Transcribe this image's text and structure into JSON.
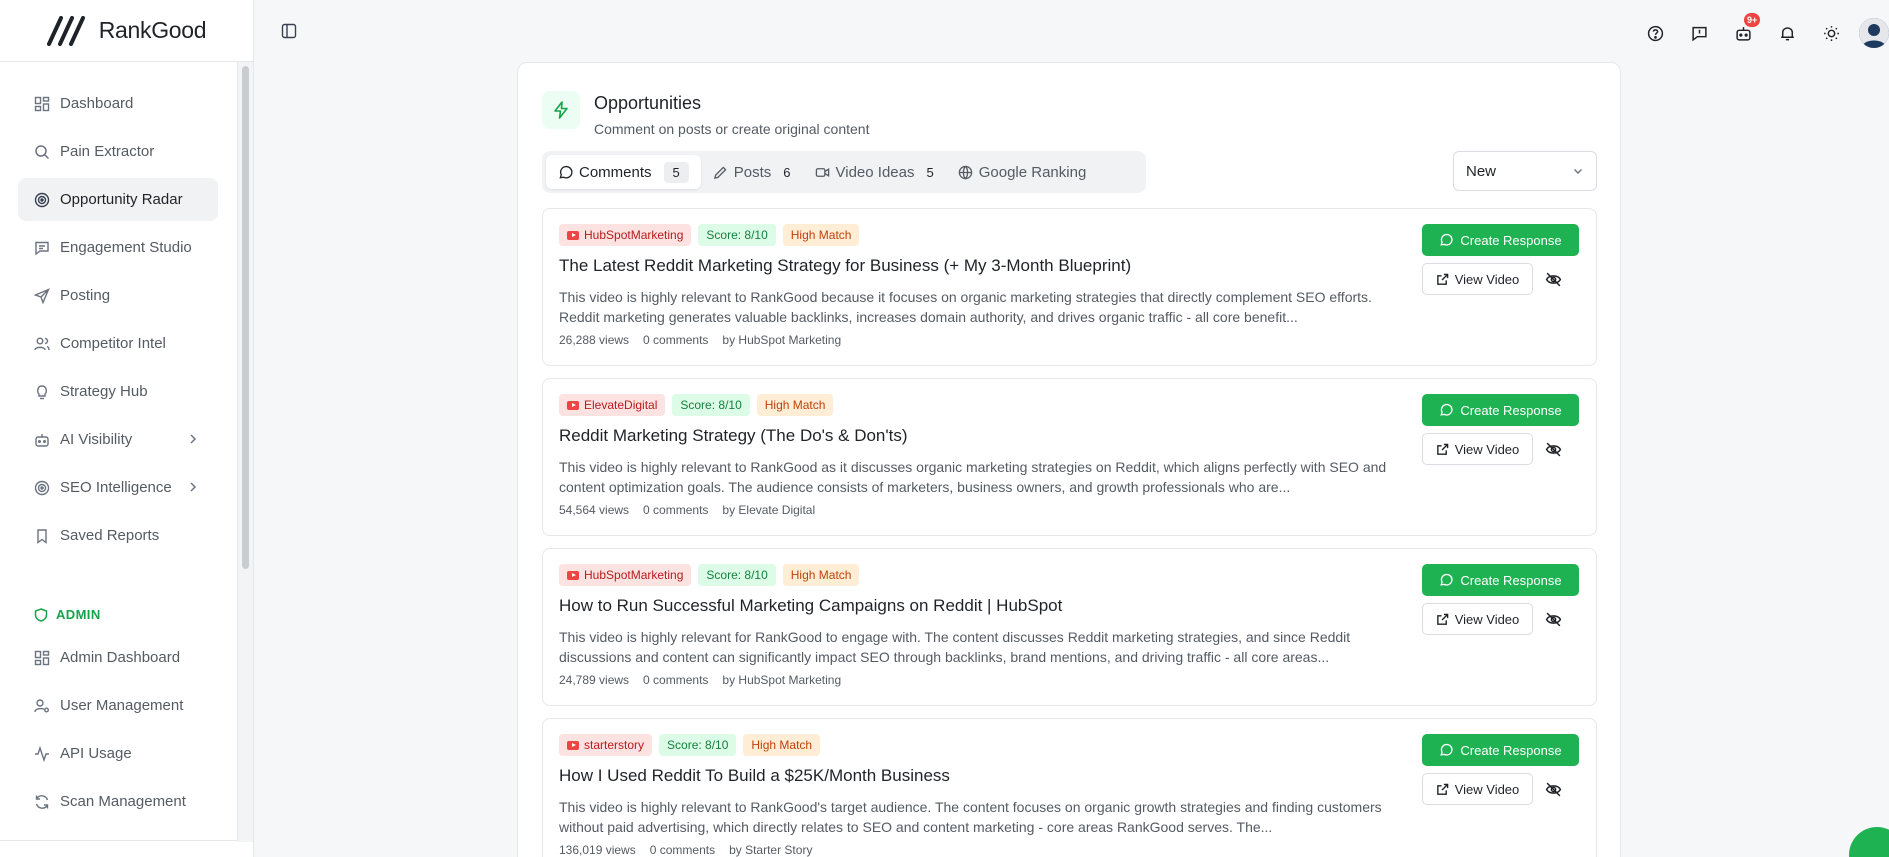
{
  "app": {
    "brand": "RankGood"
  },
  "sidebar": {
    "items": [
      {
        "label": "Dashboard",
        "icon": "dashboard-icon"
      },
      {
        "label": "Pain Extractor",
        "icon": "search-icon"
      },
      {
        "label": "Opportunity Radar",
        "icon": "radar-icon",
        "active": true
      },
      {
        "label": "Engagement Studio",
        "icon": "message-icon"
      },
      {
        "label": "Posting",
        "icon": "send-icon"
      },
      {
        "label": "Competitor Intel",
        "icon": "users-icon"
      },
      {
        "label": "Strategy Hub",
        "icon": "lightbulb-icon"
      },
      {
        "label": "AI Visibility",
        "icon": "bot-icon",
        "expandable": true
      },
      {
        "label": "SEO Intelligence",
        "icon": "radar-icon",
        "expandable": true
      },
      {
        "label": "Saved Reports",
        "icon": "bookmark-icon"
      }
    ],
    "admin_label": "ADMIN",
    "admin_items": [
      {
        "label": "Admin Dashboard",
        "icon": "dashboard-icon"
      },
      {
        "label": "User Management",
        "icon": "user-cog-icon"
      },
      {
        "label": "API Usage",
        "icon": "activity-icon"
      },
      {
        "label": "Scan Management",
        "icon": "refresh-icon"
      }
    ]
  },
  "topbar": {
    "notification_badge": "9+"
  },
  "panel": {
    "title": "Opportunities",
    "subtitle": "Comment on posts or create original content",
    "tabs": [
      {
        "label": "Comments",
        "count": "5",
        "active": true
      },
      {
        "label": "Posts",
        "count": "6"
      },
      {
        "label": "Video Ideas",
        "count": "5"
      },
      {
        "label": "Google Ranking",
        "count": ""
      }
    ],
    "sort_value": "New"
  },
  "cards": [
    {
      "channel": "HubSpotMarketing",
      "score": "Score: 8/10",
      "match": "High Match",
      "title": "The Latest Reddit Marketing Strategy for Business (+ My 3-Month Blueprint)",
      "description": "This video is highly relevant to RankGood because it focuses on organic marketing strategies that directly complement SEO efforts. Reddit marketing generates valuable backlinks, increases domain authority, and drives organic traffic - all core benefit...",
      "views": "26,288 views",
      "comments": "0 comments",
      "author": "by HubSpot Marketing"
    },
    {
      "channel": "ElevateDigital",
      "score": "Score: 8/10",
      "match": "High Match",
      "title": "Reddit Marketing Strategy (The Do's & Don'ts)",
      "description": "This video is highly relevant to RankGood as it discusses organic marketing strategies on Reddit, which aligns perfectly with SEO and content optimization goals. The audience consists of marketers, business owners, and growth professionals who are...",
      "views": "54,564 views",
      "comments": "0 comments",
      "author": "by Elevate Digital"
    },
    {
      "channel": "HubSpotMarketing",
      "score": "Score: 8/10",
      "match": "High Match",
      "title": "How to Run Successful Marketing Campaigns on Reddit | HubSpot",
      "description": "This video is highly relevant for RankGood to engage with. The content discusses Reddit marketing strategies, and since Reddit discussions and content can significantly impact SEO through backlinks, brand mentions, and driving traffic - all core areas...",
      "views": "24,789 views",
      "comments": "0 comments",
      "author": "by HubSpot Marketing"
    },
    {
      "channel": "starterstory",
      "score": "Score: 8/10",
      "match": "High Match",
      "title": "How I Used Reddit To Build a $25K/Month Business",
      "description": "This video is highly relevant to RankGood's target audience. The content focuses on organic growth strategies and finding customers without paid advertising, which directly relates to SEO and content marketing - core areas RankGood serves. The...",
      "views": "136,019 views",
      "comments": "0 comments",
      "author": "by Starter Story"
    }
  ],
  "card_actions": {
    "create": "Create Response",
    "view": "View Video"
  }
}
